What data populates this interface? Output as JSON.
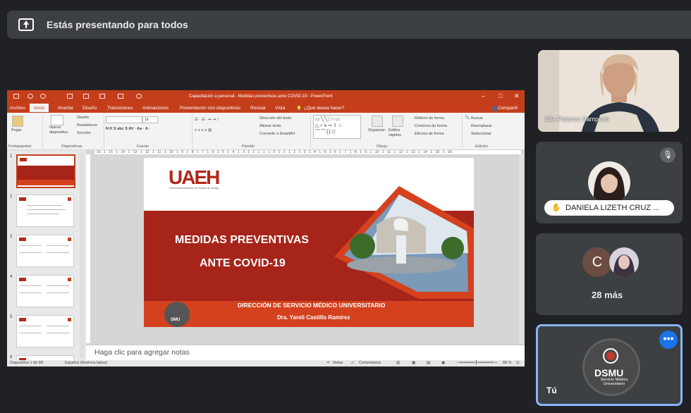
{
  "presenting_bar": {
    "text": "Estás presentando para todos",
    "icon": "present-to-all-icon"
  },
  "powerpoint": {
    "window_title": "Capacitación a personal - Medidas preventivas ante COVID-19 - PowerPoint",
    "tabs": [
      "Archivo",
      "Inicio",
      "Insertar",
      "Diseño",
      "Transiciones",
      "Animaciones",
      "Presentación con diapositivas",
      "Revisar",
      "Vista"
    ],
    "active_tab": "Inicio",
    "tell_me": "¿Qué desea hacer?",
    "share": "Compartir",
    "ribbon": {
      "paste": "Pegar",
      "new_slide": "Nueva diapositiva",
      "layout": "Diseño",
      "reset": "Restablecer",
      "section": "Sección",
      "font_size": "18",
      "text_direction": "Dirección del texto",
      "align_text": "Alinear texto",
      "convert_smartart": "Convertir a SmartArt",
      "arrange": "Organizar",
      "quick_styles": "Estilos rápidos",
      "shape_fill": "Relleno de forma",
      "shape_outline": "Contorno de forma",
      "shape_effects": "Efectos de forma",
      "find": "Buscar",
      "replace": "Reemplazar",
      "select": "Seleccionar",
      "groups": [
        "Portapapeles",
        "Diapositivas",
        "Fuente",
        "Párrafo",
        "Dibujo",
        "Edición"
      ]
    },
    "ruler_text": "· 16 · 1 · 15 · 1 · 14 · 1 · 13 · 1 · 12 · 1 · 11 · 1 · 10 · 1 · 9 · 1 · 8 · 1 · 7 · 1 · 6 · 1 · 5 · 1 · 4 · 1 · 3 · 1 · 2 · 1 · 1 · 1 · 0 · 1 · 1 · 1 · 2 · 1 · 3 · 1 · 4 · 1 · 5 · 1 · 6 · 1 · 7 · 1 · 8 · 1 · 9 · 1 · 10 · 1 · 11 · 1 · 12 · 1 · 13 · 1 · 14 · 1 · 15 · 1 · 16 ·",
    "thumbnails": [
      {
        "num": "1"
      },
      {
        "num": "2"
      },
      {
        "num": "3"
      },
      {
        "num": "4"
      },
      {
        "num": "5"
      },
      {
        "num": "6"
      }
    ],
    "slide": {
      "logo_text": "UAEH",
      "logo_subtitle": "Universidad Autónoma del Estado de Hidalgo",
      "title_line1": "MEDIDAS PREVENTIVAS",
      "title_line2": "ANTE  COVID-19",
      "direction": "DIRECCIÓN DE SERVICIO MÉDICO UNIVERSITARIO",
      "doctor": "Dra. Yareli Castillo Ramírez",
      "smu_badge": "SMU"
    },
    "notes_placeholder": "Haga clic para agregar notas",
    "status": {
      "slide_of": "Diapositiva 1 de 98",
      "language": "Español (América latina)",
      "notes": "Notas",
      "comments": "Comentarios",
      "zoom": "68 %"
    },
    "accent_color": "#c43e1c"
  },
  "participants": [
    {
      "name": "Elia Polanco Samperio",
      "muted": true
    },
    {
      "name": "DANIELA LIZETH CRUZ ...",
      "muted": true,
      "raised_hand": true
    },
    {
      "avatar_letter": "C",
      "more_label": "28 más"
    },
    {
      "name": "Tú",
      "logo_big": "DSMU",
      "logo_small": "Servicio Médico Universitario",
      "menu": "•••"
    }
  ],
  "meet_accent": "#8ab4f8"
}
